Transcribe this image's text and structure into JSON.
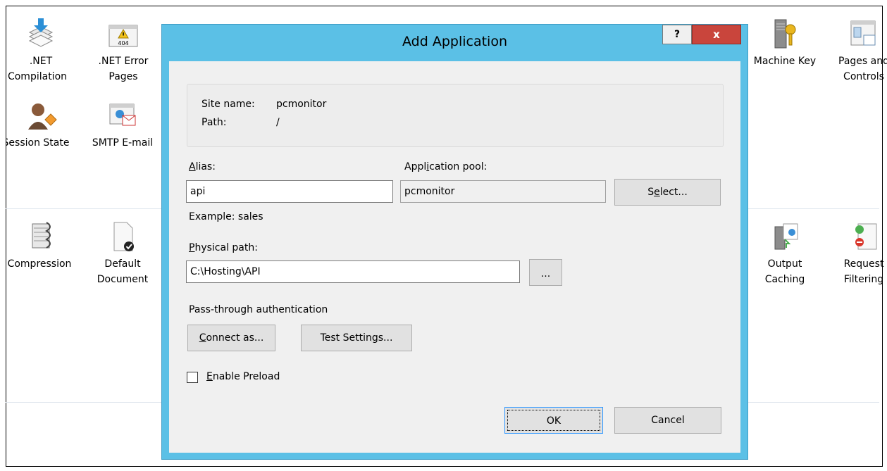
{
  "background_features": {
    "row1": [
      {
        "icon": "compilation-icon",
        "label_lines": [
          ".NET",
          "Compilation"
        ]
      },
      {
        "icon": "error-pages-icon",
        "label_lines": [
          ".NET Error",
          "Pages"
        ]
      },
      {
        "icon": "machine-key-icon",
        "label_lines": [
          "Machine Key"
        ]
      },
      {
        "icon": "pages-controls-icon",
        "label_lines": [
          "Pages and",
          "Controls"
        ]
      }
    ],
    "row1b": [
      {
        "icon": "session-state-icon",
        "label_lines": [
          "Session State"
        ]
      },
      {
        "icon": "smtp-email-icon",
        "label_lines": [
          "SMTP E-mail"
        ]
      }
    ],
    "row2": [
      {
        "icon": "compression-icon",
        "label_lines": [
          "Compression"
        ]
      },
      {
        "icon": "default-document-icon",
        "label_lines": [
          "Default",
          "Document"
        ]
      },
      {
        "icon": "output-caching-icon",
        "label_lines": [
          "Output",
          "Caching"
        ]
      },
      {
        "icon": "request-filtering-icon",
        "label_lines": [
          "Request",
          "Filtering"
        ]
      }
    ]
  },
  "dialog": {
    "title": "Add Application",
    "help_label": "?",
    "close_label": "x",
    "site_name_label": "Site name:",
    "site_name_value": "pcmonitor",
    "path_label": "Path:",
    "path_value": "/",
    "alias_label_u": "A",
    "alias_label_rest": "lias:",
    "alias_value": "api",
    "alias_example": "Example: sales",
    "app_pool_label_pre": "Appl",
    "app_pool_label_u": "i",
    "app_pool_label_rest": "cation pool:",
    "app_pool_value": "pcmonitor",
    "select_pre": "S",
    "select_u": "e",
    "select_rest": "lect...",
    "physical_path_label_u": "P",
    "physical_path_label_rest": "hysical path:",
    "physical_path_value": "C:\\Hosting\\API",
    "browse_label": "...",
    "passthrough_label": "Pass-through authentication",
    "connect_as_u": "C",
    "connect_as_rest": "onnect as...",
    "test_settings_pre": "Test Settin",
    "test_settings_u": "g",
    "test_settings_rest": "s...",
    "enable_preload_u": "E",
    "enable_preload_rest": "nable Preload",
    "enable_preload_checked": false,
    "ok_label": "OK",
    "cancel_label": "Cancel"
  },
  "colors": {
    "dialog_border": "#5bc0e6",
    "close_button": "#c9453c"
  }
}
